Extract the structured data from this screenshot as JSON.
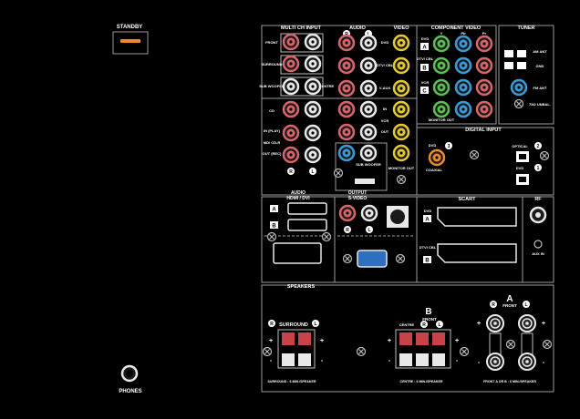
{
  "front": {
    "standby_label": "STANDBY",
    "phones_label": "PHONES",
    "standby_color": "#f08a24"
  },
  "sections": {
    "multi_ch_input": "MULTI CH INPUT",
    "audio": "AUDIO",
    "video": "VIDEO",
    "component_video": "COMPONENT VIDEO",
    "tuner": "TUNER",
    "digital_input": "DIGITAL INPUT",
    "hdmi": "AUDIO\nHDMI / DVI",
    "output_svideo": "OUTPUT\nS-VIDEO",
    "scart": "SCART",
    "rf": "RF",
    "speakers": "SPEAKERS"
  },
  "multi_ch_rows": [
    "FRONT",
    "SURROUND",
    "SUB WOOFER"
  ],
  "multi_ch_extra": "CENTRE",
  "audio_rows": [
    "DVD",
    "DTV/ CBL",
    "V-AUX",
    "IN",
    "OUT"
  ],
  "audio_vcr_label": "VCR",
  "cd_rows": [
    "CD",
    "IN (PLAY)",
    "MD/ CD-R",
    "OUT (REC)"
  ],
  "lr_labels": {
    "r": "R",
    "l": "L"
  },
  "subwoofer_out": "SUB WOOFER",
  "monitor_out": "MONITOR OUT",
  "component_cols": [
    "Y",
    "Pb",
    "Pr"
  ],
  "component_rows": [
    {
      "label": "DVD",
      "badge": "A"
    },
    {
      "label": "DTV/ CBL",
      "badge": "B"
    },
    {
      "label": "VCR",
      "badge": "C"
    }
  ],
  "component_monitor_out": "MONITOR OUT",
  "tuner_labels": [
    "AM ANT",
    "GND",
    "FM ANT",
    "75Ω UNBAL."
  ],
  "digital": {
    "dvd_label": "DVD",
    "coaxial_label": "COAXIAL",
    "coax_number": "3",
    "optical_label": "OPTICAL",
    "optical_dvd_label": "DVD",
    "optical_numbers": [
      "2",
      "1"
    ]
  },
  "hdmi_badges": [
    "A",
    "B"
  ],
  "scart_rows": [
    {
      "label": "DVD",
      "badge": "A"
    },
    {
      "label": "DTV/ CBL",
      "badge": "B"
    }
  ],
  "rf_aux": "AUX IN",
  "speakers": {
    "surround_label": "SURROUND",
    "surround_caption": "SURROUND : 6 MIN./SPEAKER",
    "b_badge": "B",
    "b_front": "FRONT",
    "centre_label": "CENTRE",
    "centre_caption": "CENTRE : 6 MIN./SPEAKER",
    "a_badge": "A",
    "a_front": "FRONT",
    "a_caption": "FRONT A OR B : 6 MIN./SPEAKER",
    "plus": "+",
    "minus": "-"
  },
  "colors": {
    "panel_line": "#9a9a9a",
    "jack_red": "#d9646a",
    "jack_white": "#e8e8e8",
    "jack_yellow": "#e6c832",
    "jack_green": "#5bbf52",
    "jack_blue": "#3d9ad6",
    "jack_orange": "#f08a24",
    "vga_blue": "#2f6fbf",
    "terminal_red": "#c8424a"
  }
}
